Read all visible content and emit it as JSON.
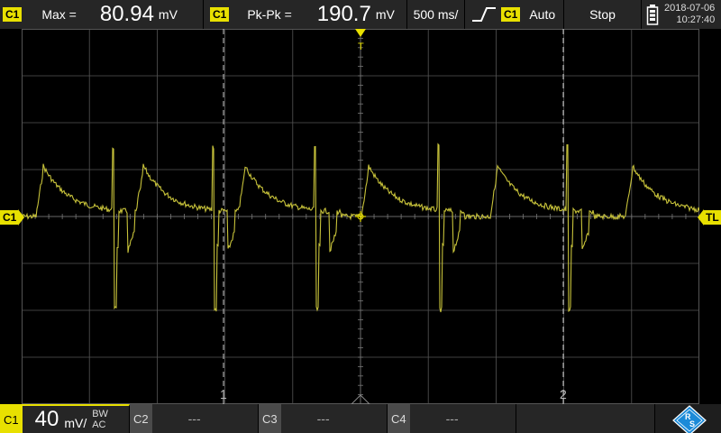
{
  "top": {
    "meas1": {
      "channel": "C1",
      "label": "Max =",
      "value": "80.94",
      "unit": "mV"
    },
    "meas2": {
      "channel": "C1",
      "label": "Pk-Pk =",
      "value": "190.7",
      "unit": "mV"
    },
    "timebase": "500 ms/",
    "trigger": {
      "channel": "C1",
      "mode": "Auto"
    },
    "run_state": "Stop",
    "date": "2018-07-06",
    "time": "10:27:40"
  },
  "screen": {
    "left_marker": "C1",
    "right_marker": "TL",
    "trigger_marker": "T",
    "cursor1_label": "1",
    "cursor2_label": "2"
  },
  "bottom": {
    "c1": {
      "label": "C1",
      "scale": "40",
      "unit": "mV/",
      "bw": "BW",
      "coupling": "AC"
    },
    "c2": {
      "label": "C2",
      "value": "---"
    },
    "c3": {
      "label": "C3",
      "value": "---"
    },
    "c4": {
      "label": "C4",
      "value": "---"
    }
  },
  "colors": {
    "trace": "#c7c23a",
    "accent": "#e8e000",
    "grid": "#555555",
    "brand": "#1b8ad8"
  },
  "icons": {
    "battery": "battery-icon",
    "trigger_edge": "rising-edge-icon",
    "logo": "rohde-schwarz-logo"
  }
}
